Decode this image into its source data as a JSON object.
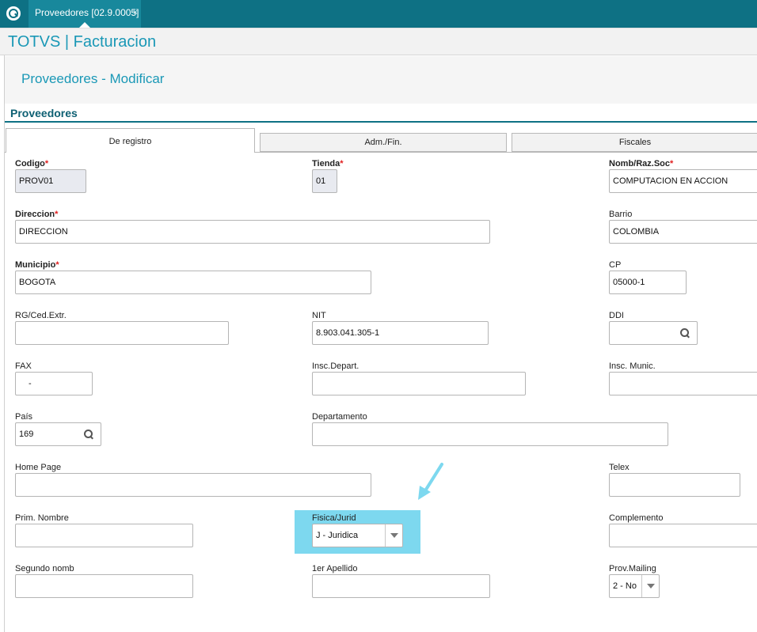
{
  "top_tab": {
    "label": "Proveedores [02.9.0005]",
    "close": "×"
  },
  "app": {
    "title": "TOTVS | Facturacion"
  },
  "page": {
    "title": "Proveedores - Modificar"
  },
  "section": {
    "title": "Proveedores"
  },
  "tabs": [
    "De registro",
    "Adm./Fin.",
    "Fiscales"
  ],
  "fields": {
    "codigo": {
      "label": "Codigo",
      "value": "PROV01"
    },
    "tienda": {
      "label": "Tienda",
      "value": "01"
    },
    "nomb": {
      "label": "Nomb/Raz.Soc",
      "value": "COMPUTACION EN ACCION"
    },
    "direccion": {
      "label": "Direccion",
      "value": "DIRECCION"
    },
    "barrio": {
      "label": "Barrio",
      "value": "COLOMBIA"
    },
    "municipio": {
      "label": "Municipio",
      "value": "BOGOTA"
    },
    "cp": {
      "label": "CP",
      "value": "05000-1"
    },
    "rg": {
      "label": "RG/Ced.Extr.",
      "value": ""
    },
    "nit": {
      "label": "NIT",
      "value": "8.903.041.305-1"
    },
    "ddi": {
      "label": "DDI",
      "value": ""
    },
    "fax": {
      "label": "FAX",
      "value": "-"
    },
    "insc_depart": {
      "label": "Insc.Depart.",
      "value": ""
    },
    "insc_munic": {
      "label": "Insc. Munic.",
      "value": ""
    },
    "pais": {
      "label": "País",
      "value": "169"
    },
    "departamento": {
      "label": "Departamento",
      "value": ""
    },
    "home_page": {
      "label": "Home Page",
      "value": ""
    },
    "telex": {
      "label": "Telex",
      "value": ""
    },
    "prim_nombre": {
      "label": "Prim. Nombre",
      "value": ""
    },
    "fisica_jurid": {
      "label": "Fisica/Jurid",
      "value": "J - Juridica"
    },
    "complemento": {
      "label": "Complemento",
      "value": ""
    },
    "segundo_nomb": {
      "label": "Segundo nomb",
      "value": ""
    },
    "apellido": {
      "label": "1er Apellido",
      "value": ""
    },
    "prov_mailing": {
      "label": "Prov.Mailing",
      "value": "2 - No"
    }
  },
  "required_marker": "*",
  "colors": {
    "topbar": "#0e7184",
    "accent": "#1a98b6",
    "highlight": "#7dd8ef",
    "required": "#e02020"
  }
}
